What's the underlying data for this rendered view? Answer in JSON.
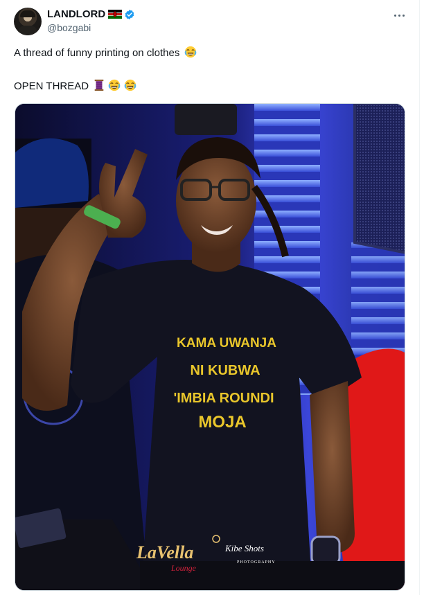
{
  "tweet": {
    "author": {
      "display_name": "LANDLORD",
      "handle": "@bozgabi",
      "flag": "kenya-flag",
      "verified": true
    },
    "text_line1": "A thread of funny printing on clothes",
    "text_line2": "OPEN THREAD",
    "emojis": [
      "face-with-tears-of-joy",
      "thread-spool"
    ]
  },
  "image": {
    "shirt_text": [
      "KAMA UWANJA",
      "NI KUBWA",
      "'IMBIA ROUNDI",
      "MOJA"
    ],
    "watermark_main": "LaVella",
    "watermark_sub": "Lounge",
    "photographer": "Kibe Shots",
    "photographer_sub": "PHOTOGRAPHY"
  },
  "colors": {
    "accent": "#1d9bf0",
    "text": "#0f1419",
    "secondary": "#536471",
    "shirt_print": "#e9c62b"
  }
}
